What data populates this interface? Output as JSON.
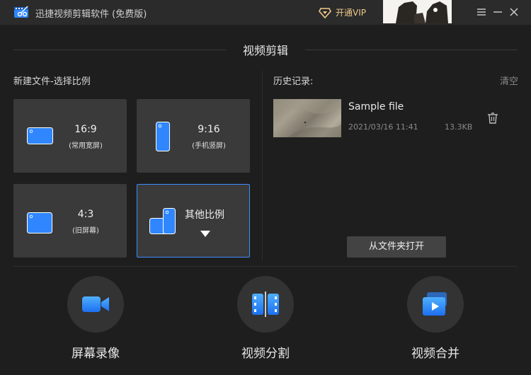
{
  "titlebar": {
    "app_title": "迅捷视频剪辑软件 (免费版)",
    "vip_label": "开通VIP"
  },
  "section_title": "视频剪辑",
  "new_file": {
    "label": "新建文件-选择比例",
    "tiles": [
      {
        "ratio": "16:9",
        "desc": "(常用宽屏)",
        "icon": "landscape-screen-icon"
      },
      {
        "ratio": "9:16",
        "desc": "(手机竖屏)",
        "icon": "portrait-screen-icon"
      },
      {
        "ratio": "4:3",
        "desc": "(旧屏幕)",
        "icon": "classic-screen-icon"
      },
      {
        "ratio": "其他比例",
        "desc": "",
        "icon": "other-ratio-icon"
      }
    ]
  },
  "history": {
    "label": "历史记录:",
    "clear_label": "清空",
    "items": [
      {
        "name": "Sample file",
        "date": "2021/03/16 11:41",
        "size": "13.3KB"
      }
    ],
    "open_folder_label": "从文件夹打开"
  },
  "tools": [
    {
      "label": "屏幕录像",
      "icon": "camera-icon"
    },
    {
      "label": "视频分割",
      "icon": "film-split-icon"
    },
    {
      "label": "视频合并",
      "icon": "video-merge-icon"
    }
  ],
  "colors": {
    "accent": "#3d8dff",
    "vip": "#f0c98a",
    "background": "#1e1e1e",
    "tile": "#3a3a3a"
  }
}
